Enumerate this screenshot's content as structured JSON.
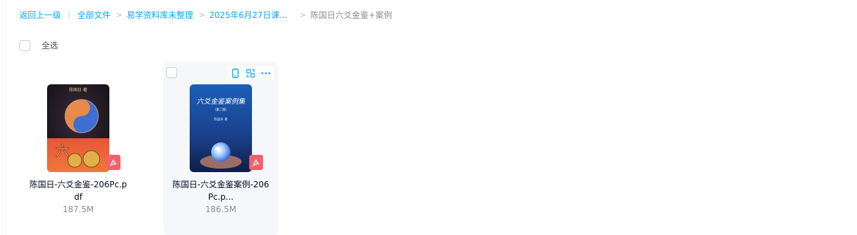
{
  "breadcrumb": {
    "back": "返回上一级",
    "divider": "|",
    "items": [
      "全部文件",
      "易学资料库未整理",
      "2025年6月27日课...",
      "陈国日六爻金鉴+案例"
    ],
    "sep": ">"
  },
  "select_all": {
    "label": "全选"
  },
  "files": [
    {
      "name_line1": "陈国日-六爻金鉴-206Pc.p",
      "name_line2": "df",
      "size": "187.5M",
      "type_icon": "pdf-icon",
      "cover_author": "陈国日 著",
      "cover_title": "六爻金鉴"
    },
    {
      "name_line1": "陈国日-六爻金鉴案例-206",
      "name_line2": "Pc.p...",
      "size": "186.5M",
      "type_icon": "pdf-icon",
      "cover_title": "六爻金鉴案例集",
      "cover_sub": "（第二版）",
      "cover_author": "陈国日 著"
    }
  ],
  "hover_actions": [
    "phone-icon",
    "share-link-icon",
    "more-icon"
  ],
  "colors": {
    "accent": "#06a7ff",
    "muted": "#878c9c",
    "pdf": "#f4606c",
    "hover_bg": "#f5f7fb"
  }
}
